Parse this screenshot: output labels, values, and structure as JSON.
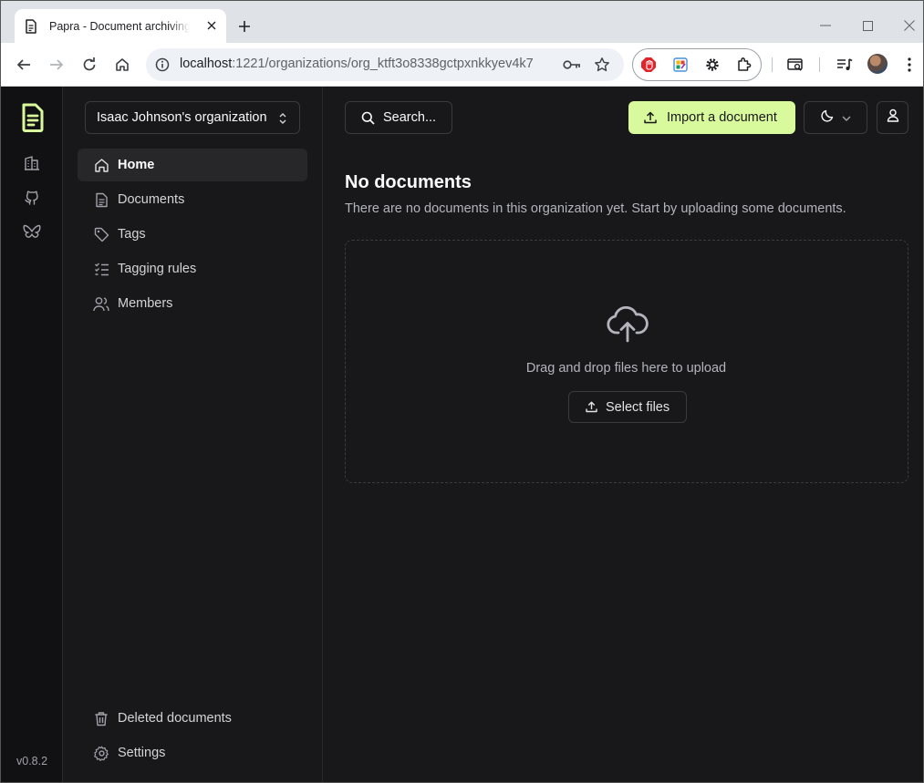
{
  "browser": {
    "tab_title": "Papra - Document archiving and management",
    "url_host": "localhost",
    "url_path": ":1221/organizations/org_ktft3o8338gctpxnkkyev4k7"
  },
  "rail": {
    "items": [
      {
        "icon": "building-icon",
        "name": "rail-organizations-button"
      },
      {
        "icon": "github-icon",
        "name": "rail-github-button"
      },
      {
        "icon": "bluesky-icon",
        "name": "rail-bluesky-button"
      }
    ],
    "version": "v0.8.2"
  },
  "sidebar": {
    "org_name": "Isaac Johnson's organization",
    "nav": [
      {
        "label": "Home",
        "icon": "home-icon",
        "active": true
      },
      {
        "label": "Documents",
        "icon": "file-icon",
        "active": false
      },
      {
        "label": "Tags",
        "icon": "tag-icon",
        "active": false
      },
      {
        "label": "Tagging rules",
        "icon": "checklist-icon",
        "active": false
      },
      {
        "label": "Members",
        "icon": "users-icon",
        "active": false
      }
    ],
    "bottom_nav": [
      {
        "label": "Deleted documents",
        "icon": "trash-icon"
      },
      {
        "label": "Settings",
        "icon": "settings-icon"
      }
    ]
  },
  "header": {
    "search_label": "Search...",
    "import_label": "Import a document"
  },
  "empty_state": {
    "title": "No documents",
    "description": "There are no documents in this organization yet. Start by uploading some documents.",
    "drop_text": "Drag and drop files here to upload",
    "select_label": "Select files"
  },
  "colors": {
    "accent": "#d9f99d",
    "background": "#18181b",
    "rail": "#111113"
  }
}
